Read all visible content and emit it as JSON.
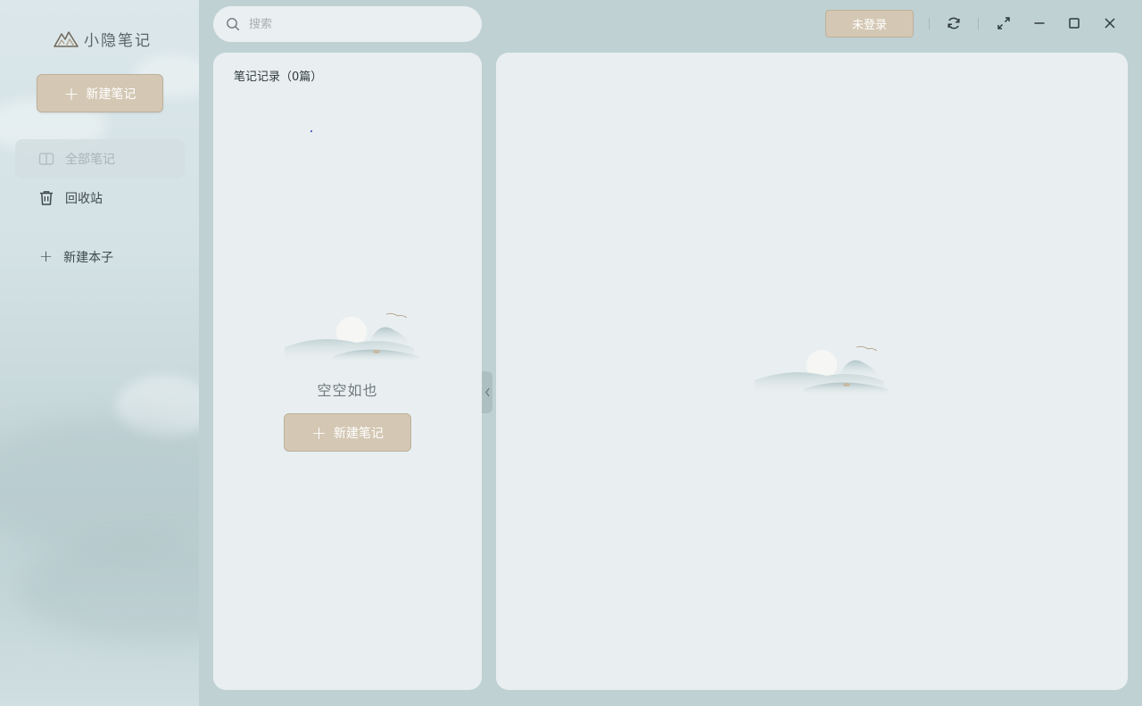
{
  "app": {
    "name": "小隐笔记"
  },
  "sidebar": {
    "new_note_label": "新建笔记",
    "items": [
      {
        "label": "全部笔记",
        "icon": "book-icon",
        "active": true
      },
      {
        "label": "回收站",
        "icon": "trash-icon",
        "active": false
      }
    ],
    "add_notebook_label": "新建本子"
  },
  "search": {
    "placeholder": "搜索",
    "value": ""
  },
  "header": {
    "login_label": "未登录"
  },
  "note_list": {
    "title": "笔记记录（0篇）",
    "empty_text": "空空如也",
    "new_note_label": "新建笔记"
  },
  "icons": {
    "refresh": "refresh-icon",
    "fullscreen": "fullscreen-icon",
    "minimize": "minimize-icon",
    "maximize": "maximize-icon",
    "close": "close-icon",
    "collapse": "chevron-left-icon"
  },
  "colors": {
    "accent_button": "#d4c8b4",
    "accent_border": "#bdb09a",
    "background": "#bfd1d3",
    "panel": "#e9eff1"
  }
}
